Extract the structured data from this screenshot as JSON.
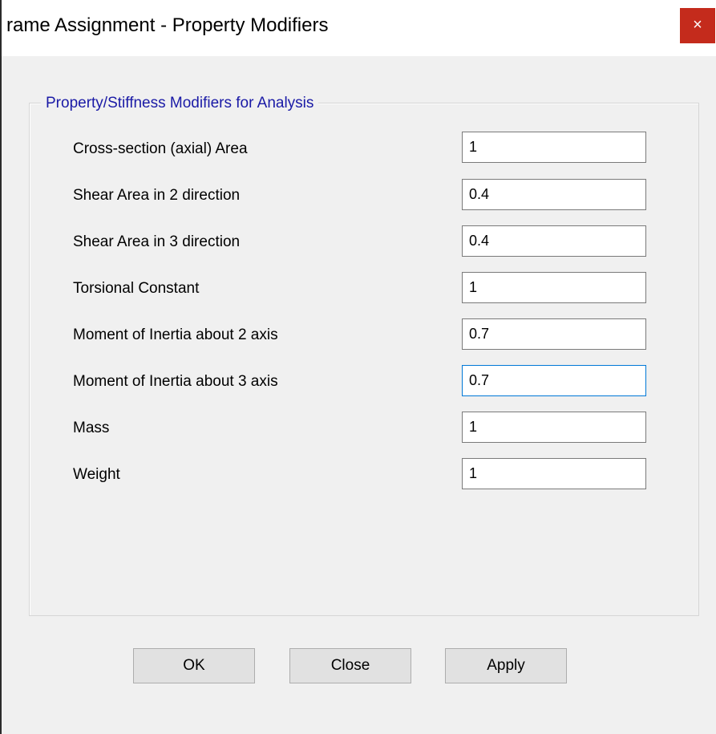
{
  "window": {
    "title": "rame Assignment - Property Modifiers",
    "close_glyph": "×"
  },
  "group": {
    "title": "Property/Stiffness Modifiers for Analysis"
  },
  "fields": [
    {
      "label": "Cross-section (axial) Area",
      "value": "1"
    },
    {
      "label": "Shear Area in 2 direction",
      "value": "0.4"
    },
    {
      "label": "Shear Area in 3 direction",
      "value": "0.4"
    },
    {
      "label": "Torsional Constant",
      "value": "1"
    },
    {
      "label": "Moment of Inertia about 2 axis",
      "value": "0.7"
    },
    {
      "label": "Moment of Inertia about 3 axis",
      "value": "0.7"
    },
    {
      "label": "Mass",
      "value": "1"
    },
    {
      "label": "Weight",
      "value": "1"
    }
  ],
  "buttons": {
    "ok": "OK",
    "close": "Close",
    "apply": "Apply"
  },
  "colors": {
    "group_title": "#1a1aa6",
    "close_button": "#c42b1c",
    "focus_border": "#0078d7"
  }
}
